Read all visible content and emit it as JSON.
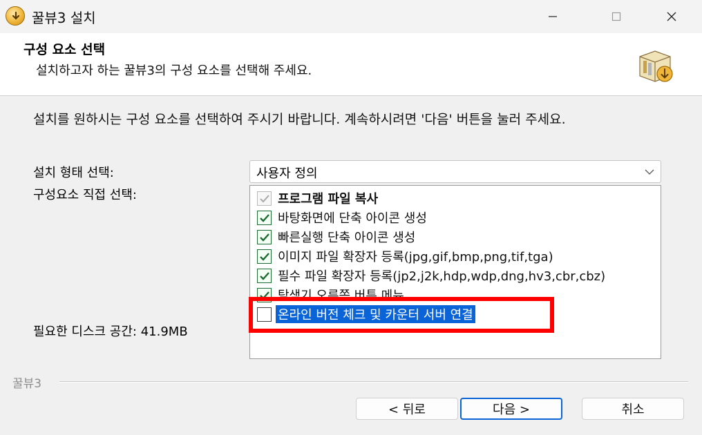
{
  "window": {
    "title": "꿀뷰3 설치",
    "controls": {
      "minimize": "minimize-icon",
      "maximize": "maximize-icon",
      "close": "close-icon"
    }
  },
  "header": {
    "title": "구성 요소 선택",
    "subtitle": "설치하고자 하는 꿀뷰3의 구성 요소를 선택해 주세요."
  },
  "intro": "설치를 원하시는 구성 요소를 선택하여 주시기 바랍니다. 계속하시려면 '다음' 버튼을 눌러 주세요.",
  "install_type": {
    "label": "설치 형태 선택:",
    "selected": "사용자 정의"
  },
  "components": {
    "label": "구성요소 직접 선택:",
    "items": [
      {
        "label": "프로그램 파일 복사",
        "checked": true,
        "disabled": true
      },
      {
        "label": "바탕화면에 단축 아이콘 생성",
        "checked": true
      },
      {
        "label": "빠른실행 단축 아이콘 생성",
        "checked": true
      },
      {
        "label": "이미지 파일 확장자 등록(jpg,gif,bmp,png,tif,tga)",
        "checked": true
      },
      {
        "label": "필수 파일 확장자 등록(jp2,j2k,hdp,wdp,dng,hv3,cbr,cbz)",
        "checked": true
      },
      {
        "label": "탐색기 오른쪽 버튼 메뉴",
        "checked": true
      },
      {
        "label": "온라인 버전 체크 및 카운터 서버 연결",
        "checked": false,
        "selected": true
      }
    ]
  },
  "disk_space": "필요한 디스크 공간: 41.9MB",
  "brand": "꿀뷰3",
  "buttons": {
    "back": "< 뒤로",
    "next": "다음 >",
    "cancel": "취소"
  },
  "colors": {
    "accent": "#0a64d8",
    "highlight_box": "#ff0000",
    "check": "#1d6b30"
  }
}
